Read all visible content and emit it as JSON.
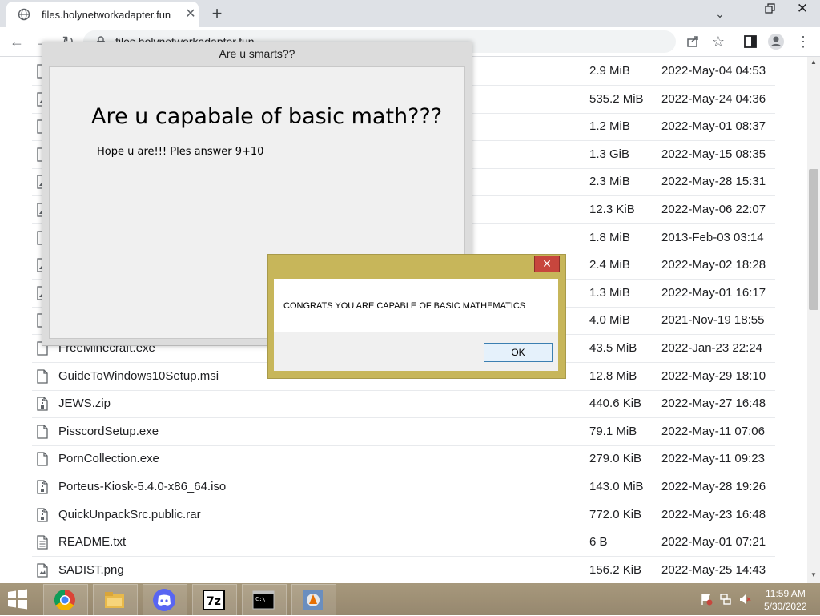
{
  "browser": {
    "tab_title": "files.holynetworkadapter.fun",
    "url": "files.holynetworkadapter.fun",
    "icons": {
      "new_tab": "plus-icon",
      "back": "arrow-left-icon",
      "forward": "arrow-right-icon",
      "reload": "reload-icon",
      "share": "share-icon",
      "star": "star-icon",
      "profile": "profile-icon",
      "menu": "vertical-dots-icon"
    }
  },
  "files": [
    {
      "name": "",
      "size": "2.9 MiB",
      "date": "2022-May-04 04:53",
      "icon": "file-icon"
    },
    {
      "name": "",
      "size": "535.2 MiB",
      "date": "2022-May-24 04:36",
      "icon": "file-image-icon"
    },
    {
      "name": "",
      "size": "1.2 MiB",
      "date": "2022-May-01 08:37",
      "icon": "file-icon"
    },
    {
      "name": "",
      "size": "1.3 GiB",
      "date": "2022-May-15 08:35",
      "icon": "file-icon"
    },
    {
      "name": "",
      "size": "2.3 MiB",
      "date": "2022-May-28 15:31",
      "icon": "file-image-icon"
    },
    {
      "name": "",
      "size": "12.3 KiB",
      "date": "2022-May-06 22:07",
      "icon": "file-image-icon"
    },
    {
      "name": "",
      "size": "1.8 MiB",
      "date": "2013-Feb-03 03:14",
      "icon": "file-icon"
    },
    {
      "name": "",
      "size": "2.4 MiB",
      "date": "2022-May-02 18:28",
      "icon": "file-image-icon"
    },
    {
      "name": "",
      "size": "1.3 MiB",
      "date": "2022-May-01 16:17",
      "icon": "file-image-icon"
    },
    {
      "name": "",
      "size": "4.0 MiB",
      "date": "2021-Nov-19 18:55",
      "icon": "file-icon"
    },
    {
      "name": "FreeMinecraft.exe",
      "size": "43.5 MiB",
      "date": "2022-Jan-23 22:24",
      "icon": "file-icon"
    },
    {
      "name": "GuideToWindows10Setup.msi",
      "size": "12.8 MiB",
      "date": "2022-May-29 18:10",
      "icon": "file-icon"
    },
    {
      "name": "JEWS.zip",
      "size": "440.6 KiB",
      "date": "2022-May-27 16:48",
      "icon": "file-archive-icon"
    },
    {
      "name": "PisscordSetup.exe",
      "size": "79.1 MiB",
      "date": "2022-May-11 07:06",
      "icon": "file-icon"
    },
    {
      "name": "PornCollection.exe",
      "size": "279.0 KiB",
      "date": "2022-May-11 09:23",
      "icon": "file-icon"
    },
    {
      "name": "Porteus-Kiosk-5.4.0-x86_64.iso",
      "size": "143.0 MiB",
      "date": "2022-May-28 19:26",
      "icon": "file-archive-icon"
    },
    {
      "name": "QuickUnpackSrc.public.rar",
      "size": "772.0 KiB",
      "date": "2022-May-23 16:48",
      "icon": "file-archive-icon"
    },
    {
      "name": "README.txt",
      "size": "6 B",
      "date": "2022-May-01 07:21",
      "icon": "file-text-icon"
    },
    {
      "name": "SADIST.png",
      "size": "156.2 KiB",
      "date": "2022-May-25 14:43",
      "icon": "file-image-icon"
    }
  ],
  "quiz_window": {
    "title": "Are u smarts??",
    "heading": "Are u capabale of basic math???",
    "question": "Hope u are!!! Ples answer 9+10"
  },
  "message_box": {
    "text": "CONGRATS YOU ARE CAPABLE OF BASIC MATHEMATICS",
    "ok_label": "OK",
    "close_label": "✕"
  },
  "taskbar": {
    "apps": [
      "chrome-icon",
      "file-explorer-icon",
      "discord-icon",
      "7zip-icon",
      "command-prompt-icon",
      "java-icon"
    ],
    "clock_time": "11:59 AM",
    "clock_date": "5/30/2022"
  },
  "colors": {
    "msgbox_frame": "#c7b65a",
    "close_red": "#c7463d",
    "ok_border": "#3c7fb1"
  }
}
